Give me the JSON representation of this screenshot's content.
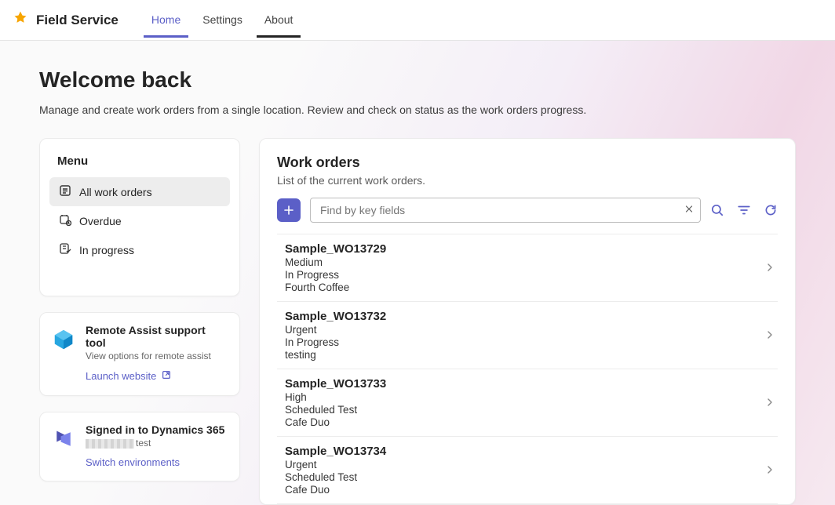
{
  "app": {
    "name": "Field Service",
    "tabs": [
      "Home",
      "Settings",
      "About"
    ],
    "active_tab": 0
  },
  "hero": {
    "title": "Welcome back",
    "subtitle": "Manage and create work orders from a single location. Review and check on status as the work orders progress."
  },
  "menu": {
    "title": "Menu",
    "items": [
      {
        "icon": "list-icon",
        "label": "All work orders",
        "active": true
      },
      {
        "icon": "overdue-icon",
        "label": "Overdue",
        "active": false
      },
      {
        "icon": "inprogress-icon",
        "label": "In progress",
        "active": false
      }
    ]
  },
  "support": {
    "title": "Remote Assist support tool",
    "subtitle": "View options for remote assist",
    "link_label": "Launch website"
  },
  "signin": {
    "title": "Signed in to Dynamics 365",
    "suffix": "test",
    "link_label": "Switch environments"
  },
  "work_orders": {
    "title": "Work orders",
    "subtitle": "List of the current work orders.",
    "search_placeholder": "Find by key fields",
    "items": [
      {
        "name": "Sample_WO13729",
        "priority": "Medium",
        "status": "In Progress",
        "account": "Fourth Coffee"
      },
      {
        "name": "Sample_WO13732",
        "priority": "Urgent",
        "status": "In Progress",
        "account": "testing"
      },
      {
        "name": "Sample_WO13733",
        "priority": "High",
        "status": "Scheduled Test",
        "account": "Cafe Duo"
      },
      {
        "name": "Sample_WO13734",
        "priority": "Urgent",
        "status": "Scheduled Test",
        "account": "Cafe Duo"
      }
    ]
  }
}
